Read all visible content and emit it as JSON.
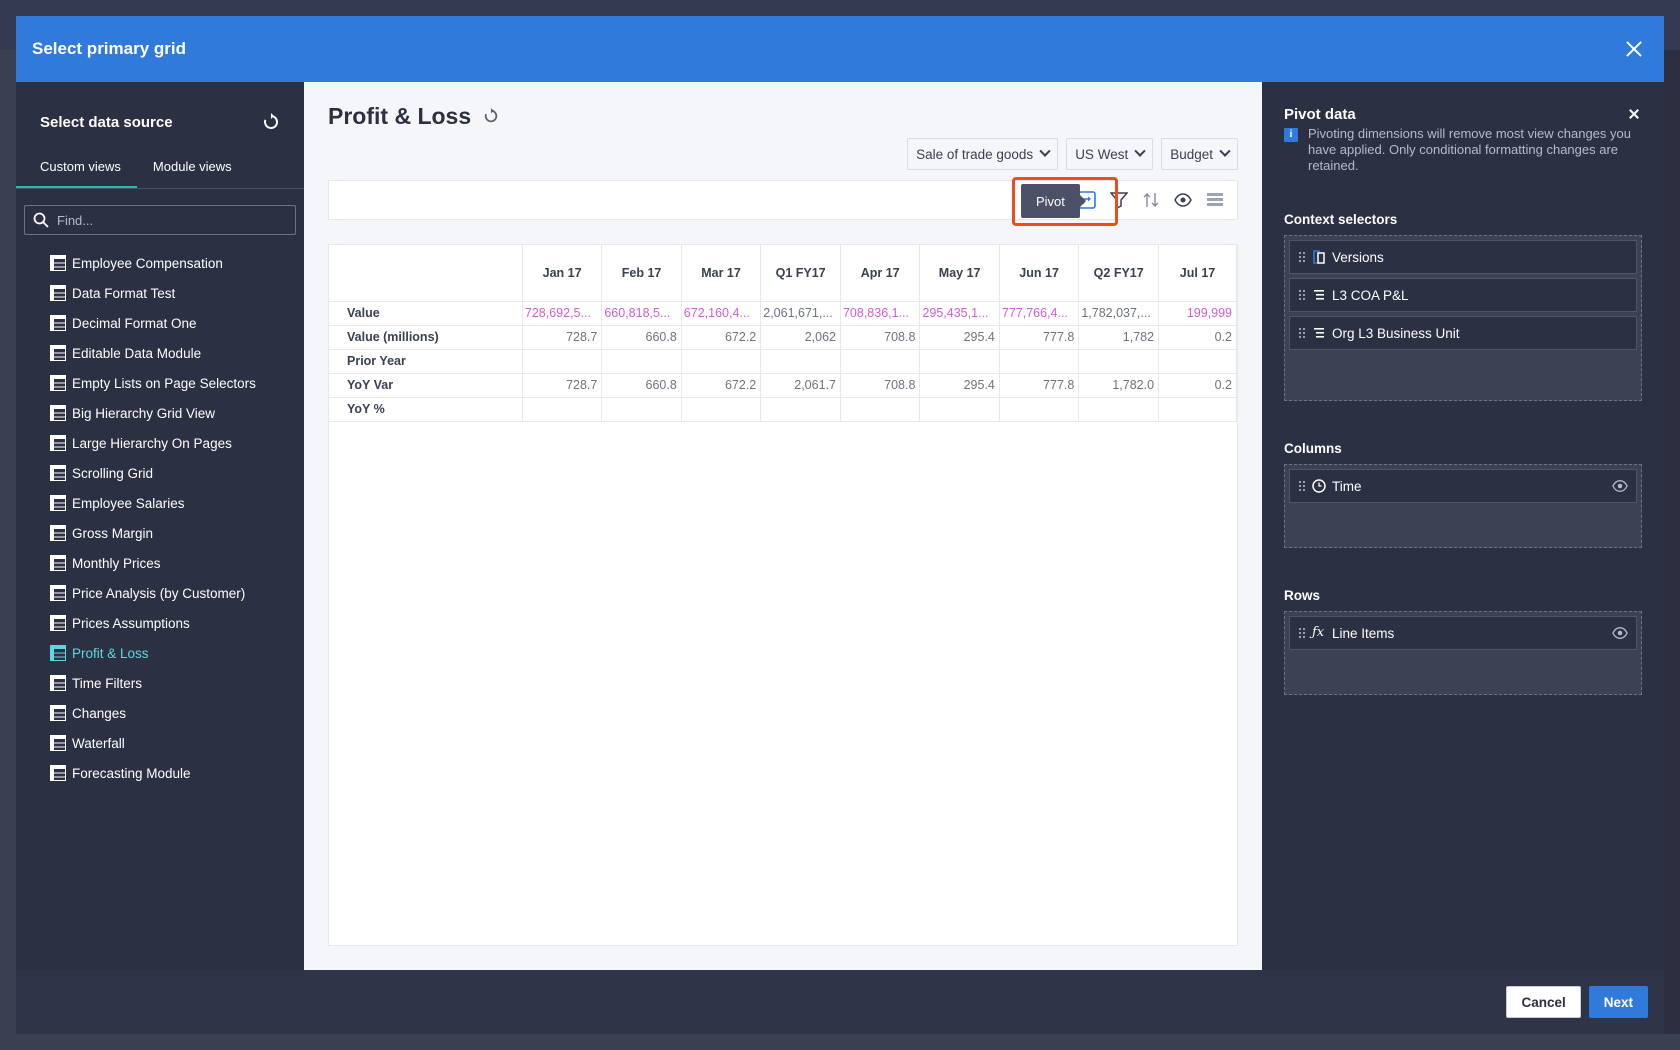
{
  "modal": {
    "title": "Select primary grid"
  },
  "left": {
    "title": "Select data source",
    "tabs": [
      {
        "label": "Custom views"
      },
      {
        "label": "Module views"
      }
    ],
    "search_placeholder": "Find...",
    "items": [
      {
        "label": "Employee Compensation"
      },
      {
        "label": "Data Format Test"
      },
      {
        "label": "Decimal Format One"
      },
      {
        "label": "Editable Data Module"
      },
      {
        "label": "Empty Lists on Page Selectors"
      },
      {
        "label": "Big Hierarchy Grid View"
      },
      {
        "label": "Large Hierarchy On Pages"
      },
      {
        "label": "Scrolling Grid"
      },
      {
        "label": "Employee Salaries"
      },
      {
        "label": "Gross Margin"
      },
      {
        "label": "Monthly Prices"
      },
      {
        "label": "Price Analysis (by Customer)"
      },
      {
        "label": "Prices Assumptions"
      },
      {
        "label": "Profit & Loss"
      },
      {
        "label": "Time Filters"
      },
      {
        "label": "Changes"
      },
      {
        "label": "Waterfall"
      },
      {
        "label": "Forecasting Module"
      }
    ],
    "active_item": "Profit & Loss"
  },
  "center": {
    "title": "Profit & Loss",
    "selectors": [
      {
        "label": "Sale of trade goods"
      },
      {
        "label": "US West"
      },
      {
        "label": "Budget"
      }
    ],
    "tooltip": "Pivot",
    "grid": {
      "columns": [
        "Jan 17",
        "Feb 17",
        "Mar 17",
        "Q1 FY17",
        "Apr 17",
        "May 17",
        "Jun 17",
        "Q2 FY17",
        "Jul 17"
      ],
      "rows": [
        {
          "label": "Value",
          "cells": [
            "728,692,5...",
            "660,818,5...",
            "672,160,4...",
            "2,061,671,...",
            "708,836,1...",
            "295,435,1...",
            "777,766,4...",
            "1,782,037,...",
            "199,999"
          ]
        },
        {
          "label": "Value (millions)",
          "cells": [
            "728.7",
            "660.8",
            "672.2",
            "2,062",
            "708.8",
            "295.4",
            "777.8",
            "1,782",
            "0.2"
          ]
        },
        {
          "label": "Prior Year",
          "cells": [
            "",
            "",
            "",
            "",
            "",
            "",
            "",
            "",
            ""
          ]
        },
        {
          "label": "YoY Var",
          "cells": [
            "728.7",
            "660.8",
            "672.2",
            "2,061.7",
            "708.8",
            "295.4",
            "777.8",
            "1,782.0",
            "0.2"
          ]
        },
        {
          "label": "YoY %",
          "cells": [
            "",
            "",
            "",
            "",
            "",
            "",
            "",
            "",
            ""
          ]
        }
      ]
    }
  },
  "right": {
    "title": "Pivot data",
    "info": "Pivoting dimensions will remove most view changes you have applied. Only conditional formatting changes are retained.",
    "context_label": "Context selectors",
    "context": [
      {
        "label": "Versions"
      },
      {
        "label": "L3 COA P&L"
      },
      {
        "label": "Org L3 Business Unit"
      }
    ],
    "columns_label": "Columns",
    "columns": [
      {
        "label": "Time"
      }
    ],
    "rows_label": "Rows",
    "rows": [
      {
        "label": "Line Items"
      }
    ]
  },
  "footer": {
    "cancel": "Cancel",
    "next": "Next"
  },
  "colors": {
    "header": "#2f7adb",
    "accent": "#2fb8b0",
    "active_item": "#5ed8e0",
    "highlight": "#ec4d1d",
    "pink_values": "#cb5fd6"
  }
}
